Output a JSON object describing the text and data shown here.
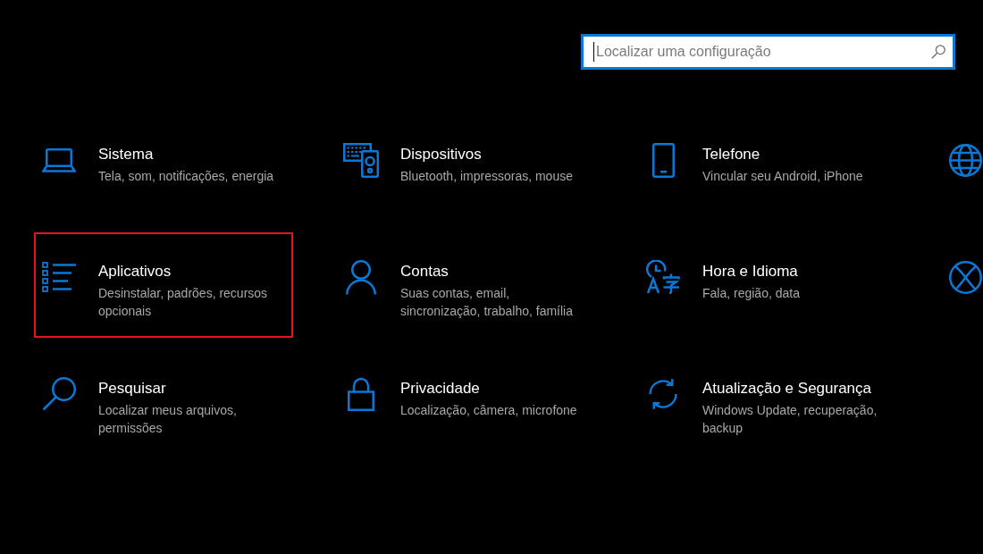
{
  "search": {
    "placeholder": "Localizar uma configuração",
    "focused": true
  },
  "categories": [
    {
      "kind": "tile",
      "title": "Sistema",
      "description": "Tela, som, notificações, energia",
      "highlighted": false
    },
    {
      "kind": "tile",
      "title": "Dispositivos",
      "description": "Bluetooth, impressoras, mouse",
      "highlighted": false
    },
    {
      "kind": "tile",
      "title": "Telefone",
      "description": "Vincular seu Android, iPhone",
      "highlighted": false
    },
    {
      "kind": "cut-off"
    },
    {
      "kind": "tile",
      "title": "Aplicativos",
      "description": "Desinstalar, padrões, recursos opcionais",
      "highlighted": true
    },
    {
      "kind": "tile",
      "title": "Contas",
      "description": "Suas contas, email, sincronização, trabalho, família",
      "highlighted": false
    },
    {
      "kind": "tile",
      "title": "Hora e Idioma",
      "description": "Fala, região, data",
      "highlighted": false
    },
    {
      "kind": "cut-off"
    },
    {
      "kind": "tile",
      "title": "Pesquisar",
      "description": "Localizar meus arquivos, permissões",
      "highlighted": false
    },
    {
      "kind": "tile",
      "title": "Privacidade",
      "description": "Localização, câmera, microfone",
      "highlighted": false
    },
    {
      "kind": "tile",
      "title": "Atualização e Segurança",
      "description": "Windows Update, recuperação, backup",
      "highlighted": false
    }
  ]
}
